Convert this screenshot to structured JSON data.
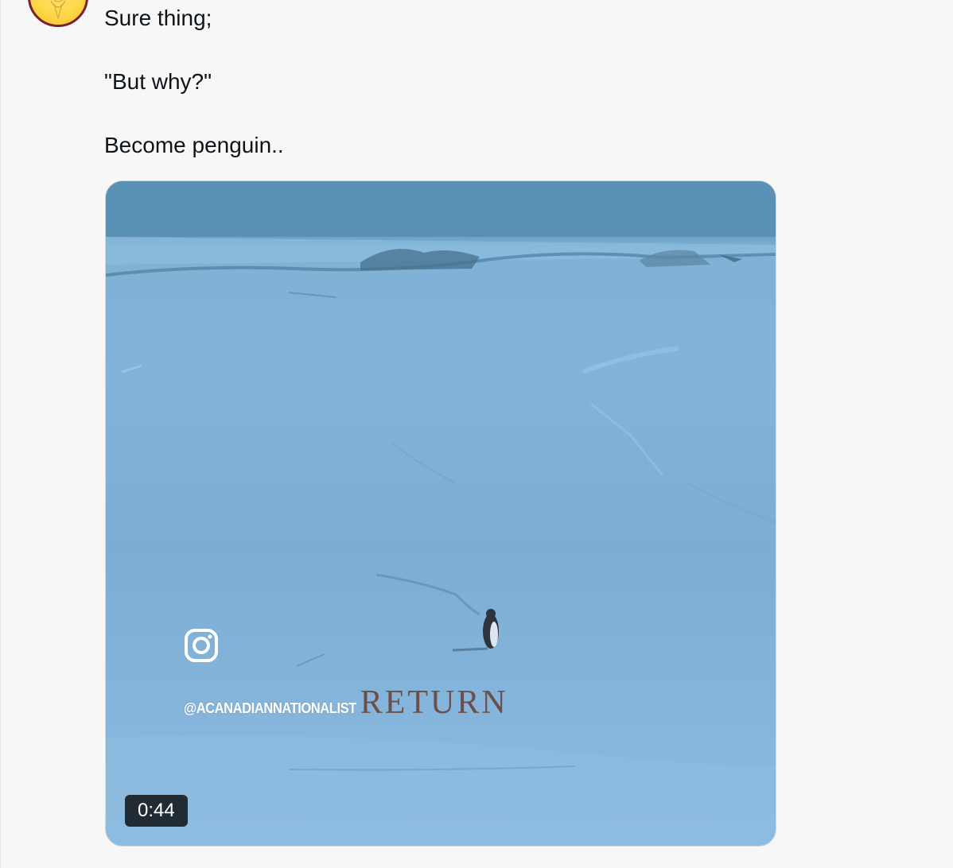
{
  "tweet": {
    "lines": [
      "Sure thing;",
      "\"But why?\"",
      "Become penguin.."
    ]
  },
  "media": {
    "type": "video",
    "watermark_handle": "@ACANADIANNATIONALIST",
    "overlay_title": "RETURN",
    "duration": "0:44",
    "watermark_icon": "instagram-icon"
  },
  "colors": {
    "page_bg": "#f7f7f7",
    "text": "#0f1419",
    "avatar_border": "#7a2030",
    "avatar_fill": "#ffd84a",
    "overlay_title": "#6b4f48",
    "duration_badge_bg": "#000000c4"
  }
}
